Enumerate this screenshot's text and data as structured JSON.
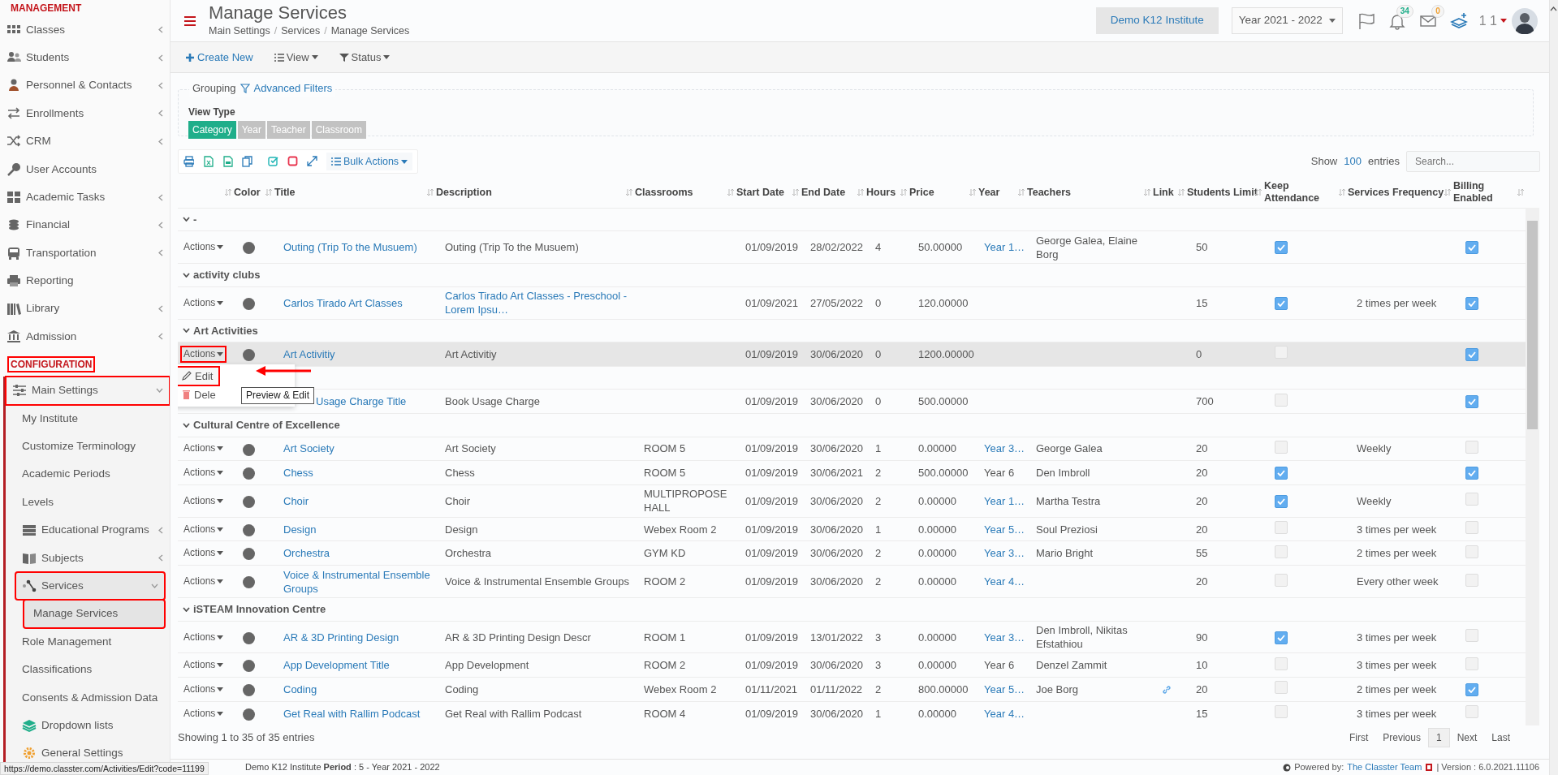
{
  "sidebar": {
    "sections": [
      {
        "title": "MANAGEMENT",
        "annotated": false,
        "items": [
          {
            "label": "Classes",
            "has_children": true
          },
          {
            "label": "Students",
            "has_children": true
          },
          {
            "label": "Personnel & Contacts",
            "has_children": true
          },
          {
            "label": "Enrollments",
            "has_children": true
          },
          {
            "label": "CRM",
            "has_children": true
          },
          {
            "label": "User Accounts",
            "has_children": false
          },
          {
            "label": "Academic Tasks",
            "has_children": true
          },
          {
            "label": "Financial",
            "has_children": true
          },
          {
            "label": "Transportation",
            "has_children": true
          },
          {
            "label": "Reporting",
            "has_children": false
          },
          {
            "label": "Library",
            "has_children": true
          },
          {
            "label": "Admission",
            "has_children": true
          }
        ]
      },
      {
        "title": "CONFIGURATION",
        "annotated": true,
        "items": [
          {
            "label": "Main Settings",
            "has_children": true,
            "expanded": true,
            "annotated": true,
            "children": [
              {
                "label": "My Institute",
                "has_children": false
              },
              {
                "label": "Customize Terminology",
                "has_children": false
              },
              {
                "label": "Academic Periods",
                "has_children": false
              },
              {
                "label": "Levels",
                "has_children": false
              },
              {
                "label": "Educational Programs",
                "has_children": true
              },
              {
                "label": "Subjects",
                "has_children": true
              },
              {
                "label": "Services",
                "has_children": true,
                "expanded": true,
                "annotated": true,
                "children": [
                  {
                    "label": "Manage Services",
                    "selected": true,
                    "annotated": true
                  }
                ]
              },
              {
                "label": "Role Management",
                "has_children": false
              },
              {
                "label": "Classifications",
                "has_children": false
              },
              {
                "label": "Consents & Admission Data",
                "has_children": false
              },
              {
                "label": "Dropdown lists",
                "has_children": false
              },
              {
                "label": "General Settings",
                "has_children": false
              }
            ]
          }
        ]
      }
    ]
  },
  "header": {
    "title": "Manage Services",
    "breadcrumb": [
      {
        "label": "Main Settings",
        "kind": "link"
      },
      {
        "label": "/",
        "kind": "separator"
      },
      {
        "label": "Services",
        "kind": "link"
      },
      {
        "label": "/",
        "kind": "separator"
      },
      {
        "label": "Manage Services",
        "kind": "current"
      }
    ],
    "institute": "Demo K12 Institute",
    "year": "Year 2021 - 2022",
    "notifications": "34",
    "messages": "0",
    "user": "1 1"
  },
  "toolbar": [
    {
      "label": "Create New",
      "dropdown": false
    },
    {
      "label": "View",
      "dropdown": true
    },
    {
      "label": "Status",
      "dropdown": true
    }
  ],
  "grouping": {
    "legend": "Grouping",
    "advanced": "Advanced Filters",
    "view_type_label": "View Type",
    "view_types": [
      {
        "label": "Category",
        "selected": true
      },
      {
        "label": "Year",
        "selected": false
      },
      {
        "label": "Teacher",
        "selected": false
      },
      {
        "label": "Classroom",
        "selected": false
      }
    ]
  },
  "table_tools": {
    "bulk": "Bulk Actions",
    "show": "Show",
    "page_size": "100",
    "entries": "entries",
    "search_placeholder": "Search..."
  },
  "table": {
    "columns": [
      "",
      "Color",
      "Title",
      "Description",
      "Classrooms",
      "Start Date",
      "End Date",
      "Hours",
      "Price",
      "Year",
      "Teachers",
      "Link",
      "Students Limit",
      "Keep Attendance",
      "Services Frequency",
      "Billing Enabled"
    ],
    "rows": [
      {
        "kind": "group",
        "label": "-"
      },
      {
        "kind": "row",
        "actions": "Actions",
        "title": "Outing (Trip To the Musuem)",
        "description": "Outing (Trip To the Musuem)",
        "description_link": false,
        "start_date": "01/09/2019",
        "end_date": "28/02/2022",
        "hours": "4",
        "price": "50.00000",
        "year": "Year 1…",
        "year_link": true,
        "teachers": "George Galea, Elaine Borg",
        "link": false,
        "students_limit": "50",
        "keep_attendance": true,
        "billing_enabled": true,
        "highlighted": false,
        "menu_open": false
      },
      {
        "kind": "group",
        "label": "activity clubs"
      },
      {
        "kind": "row",
        "actions": "Actions",
        "title": "Carlos Tirado Art Classes",
        "description": "Carlos Tirado Art Classes - Preschool - Lorem Ipsu…",
        "description_link": true,
        "start_date": "01/09/2021",
        "end_date": "27/05/2022",
        "hours": "0",
        "price": "120.00000",
        "link": false,
        "students_limit": "15",
        "keep_attendance": true,
        "frequency": "2 times per week",
        "billing_enabled": true,
        "highlighted": false,
        "menu_open": false
      },
      {
        "kind": "group",
        "label": "Art Activities"
      },
      {
        "kind": "row",
        "actions": "Actions",
        "actions_annotated": true,
        "title": "Art Activitiy",
        "description": "Art Activitiy",
        "description_link": false,
        "start_date": "01/09/2019",
        "end_date": "30/06/2020",
        "hours": "0",
        "price": "1200.00000",
        "link": false,
        "students_limit": "0",
        "keep_attendance": false,
        "billing_enabled": true,
        "highlighted": true,
        "menu_open": true
      },
      {
        "kind": "group"
      },
      {
        "kind": "row",
        "title": "Usage Charge Title",
        "description": "Book Usage Charge",
        "description_link": false,
        "start_date": "01/09/2019",
        "end_date": "30/06/2020",
        "hours": "0",
        "price": "500.00000",
        "link": false,
        "students_limit": "700",
        "keep_attendance": false,
        "billing_enabled": true,
        "highlighted": false,
        "menu_open": false
      },
      {
        "kind": "group",
        "label": "Cultural Centre of Excellence"
      },
      {
        "kind": "row",
        "actions": "Actions",
        "title": "Art Society",
        "description": "Art Society",
        "description_link": false,
        "classrooms": "ROOM 5",
        "start_date": "01/09/2019",
        "end_date": "30/06/2020",
        "hours": "1",
        "price": "0.00000",
        "year": "Year 3…",
        "year_link": true,
        "teachers": "George Galea",
        "link": false,
        "students_limit": "20",
        "keep_attendance": false,
        "frequency": "Weekly",
        "billing_enabled": false,
        "highlighted": false,
        "menu_open": false
      },
      {
        "kind": "row",
        "actions": "Actions",
        "title": "Chess",
        "description": "Chess",
        "description_link": false,
        "classrooms": "ROOM 5",
        "start_date": "01/09/2019",
        "end_date": "30/06/2021",
        "hours": "2",
        "price": "500.00000",
        "year": "Year 6",
        "year_link": false,
        "teachers": "Den Imbroll",
        "link": false,
        "students_limit": "20",
        "keep_attendance": true,
        "billing_enabled": true,
        "highlighted": false,
        "menu_open": false
      },
      {
        "kind": "row",
        "actions": "Actions",
        "title": "Choir",
        "description": "Choir",
        "description_link": false,
        "classrooms": "MULTIPROPOSE HALL",
        "start_date": "01/09/2019",
        "end_date": "30/06/2020",
        "hours": "2",
        "price": "0.00000",
        "year": "Year 1…",
        "year_link": true,
        "teachers": "Martha Testra",
        "link": false,
        "students_limit": "20",
        "keep_attendance": true,
        "frequency": "Weekly",
        "billing_enabled": false,
        "highlighted": false,
        "menu_open": false
      },
      {
        "kind": "row",
        "actions": "Actions",
        "title": "Design",
        "description": "Design",
        "description_link": false,
        "classrooms": "Webex Room 2",
        "start_date": "01/09/2019",
        "end_date": "30/06/2020",
        "hours": "1",
        "price": "0.00000",
        "year": "Year 5…",
        "year_link": true,
        "teachers": "Soul Preziosi",
        "link": false,
        "students_limit": "20",
        "keep_attendance": false,
        "frequency": "3 times per week",
        "billing_enabled": false,
        "highlighted": false,
        "menu_open": false
      },
      {
        "kind": "row",
        "actions": "Actions",
        "title": "Orchestra",
        "description": "Orchestra",
        "description_link": false,
        "classrooms": "GYM KD",
        "start_date": "01/09/2019",
        "end_date": "30/06/2020",
        "hours": "2",
        "price": "0.00000",
        "year": "Year 3…",
        "year_link": true,
        "teachers": "Mario Bright",
        "link": false,
        "students_limit": "55",
        "keep_attendance": false,
        "frequency": "2 times per week",
        "billing_enabled": false,
        "highlighted": false,
        "menu_open": false
      },
      {
        "kind": "row",
        "actions": "Actions",
        "title": "Voice & Instrumental Ensemble Groups",
        "description": "Voice & Instrumental Ensemble Groups",
        "description_link": false,
        "classrooms": "ROOM 2",
        "start_date": "01/09/2019",
        "end_date": "30/06/2020",
        "hours": "2",
        "price": "0.00000",
        "year": "Year 4…",
        "year_link": true,
        "link": false,
        "students_limit": "20",
        "keep_attendance": false,
        "frequency": "Every other week",
        "billing_enabled": false,
        "highlighted": false,
        "menu_open": false
      },
      {
        "kind": "group",
        "label": "iSTEAM Innovation Centre"
      },
      {
        "kind": "row",
        "actions": "Actions",
        "title": "AR & 3D Printing Design",
        "description": "AR & 3D Printing Design Descr",
        "description_link": false,
        "classrooms": "ROOM 1",
        "start_date": "01/09/2019",
        "end_date": "13/01/2022",
        "hours": "3",
        "price": "0.00000",
        "year": "Year 3…",
        "year_link": true,
        "teachers": "Den Imbroll, Nikitas Efstathiou",
        "link": false,
        "students_limit": "90",
        "keep_attendance": true,
        "frequency": "3 times per week",
        "billing_enabled": false,
        "highlighted": false,
        "menu_open": false
      },
      {
        "kind": "row",
        "actions": "Actions",
        "title": "App Development Title",
        "description": "App Development",
        "description_link": false,
        "classrooms": "ROOM 2",
        "start_date": "01/09/2019",
        "end_date": "30/06/2020",
        "hours": "3",
        "price": "0.00000",
        "year": "Year 6",
        "year_link": false,
        "teachers": "Denzel Zammit",
        "link": false,
        "students_limit": "10",
        "keep_attendance": false,
        "frequency": "3 times per week",
        "billing_enabled": false,
        "highlighted": false,
        "menu_open": false
      },
      {
        "kind": "row",
        "actions": "Actions",
        "title": "Coding",
        "description": "Coding",
        "description_link": false,
        "classrooms": "Webex Room 2",
        "start_date": "01/11/2021",
        "end_date": "01/11/2022",
        "hours": "2",
        "price": "800.00000",
        "year": "Year 5…",
        "year_link": true,
        "teachers": "Joe Borg",
        "link": true,
        "students_limit": "20",
        "keep_attendance": false,
        "frequency": "2 times per week",
        "billing_enabled": true,
        "highlighted": false,
        "menu_open": false
      },
      {
        "kind": "row",
        "actions": "Actions",
        "title": "Get Real with Rallim Podcast",
        "description": "Get Real with Rallim Podcast",
        "description_link": false,
        "classrooms": "ROOM 4",
        "start_date": "01/09/2019",
        "end_date": "30/06/2020",
        "hours": "1",
        "price": "0.00000",
        "year": "Year 4…",
        "year_link": true,
        "link": false,
        "students_limit": "15",
        "keep_attendance": false,
        "frequency": "3 times per week",
        "billing_enabled": false,
        "highlighted": false,
        "menu_open": false
      }
    ]
  },
  "menu": {
    "items": [
      {
        "label": "Edit",
        "kind": "edit",
        "annotated": true
      },
      {
        "label": "Dele",
        "kind": "delete",
        "annotated": false
      }
    ],
    "tooltip": "Preview & Edit"
  },
  "footer": {
    "info": "Showing 1 to 35 of 35 entries",
    "pagination": [
      {
        "label": "First",
        "selected": false
      },
      {
        "label": "Previous",
        "selected": false
      },
      {
        "label": "1",
        "selected": true
      },
      {
        "label": "Next",
        "selected": false
      },
      {
        "label": "Last",
        "selected": false
      }
    ]
  },
  "status_bar": {
    "url": "https://demo.classter.com/Activities/Edit?code=11199",
    "info": "Demo K12 Institute **Period** : 5 - Year 2021 - 2022",
    "powered_by": "Powered by:",
    "team": "The Classter Team",
    "version": "| Version : 6.0.2021.11106"
  }
}
